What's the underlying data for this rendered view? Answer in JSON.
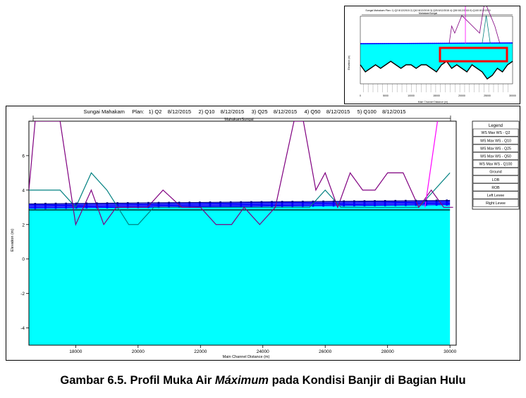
{
  "caption": {
    "prefix": "Gambar 6.5. Profil Muka Air ",
    "italic": "Máximum",
    "suffix": " pada Kondisi Banjir di Bagian Hulu"
  },
  "colors": {
    "water_fill": "#00ffff",
    "ws": "#0000ff",
    "ground": "#000000",
    "lob": "#008080",
    "rob": "#800080",
    "left_levee": "#ff00ff",
    "right_levee": "#00008b",
    "zoom_box": "#ff0000"
  },
  "chart_data": [
    {
      "type": "line",
      "title": "Sungai Mahakam     Plan:   1) Q2    8/12/2015     2) Q10    8/12/2015     3) Q25    8/12/2015     4) Q50    8/12/2015     5) Q100    8/12/2015",
      "reach_label": "MahakamSungai",
      "xlabel": "Main Channel Distance (m)",
      "ylabel": "Elevation (m)",
      "xlim": [
        16500,
        30200
      ],
      "ylim": [
        -5,
        8
      ],
      "x_ticks": [
        "18000",
        "20000",
        "22000",
        "24000",
        "26000",
        "28000",
        "30000"
      ],
      "y_ticks": [
        "-4",
        "-2",
        "0",
        "2",
        "4",
        "6"
      ],
      "grid": false,
      "legend_position": "right",
      "legend": {
        "title": "Legend",
        "items": [
          "WS Max WS - Q2",
          "WS Max WS - Q10",
          "WS Max WS - Q25",
          "WS Max WS - Q50",
          "WS Max WS - Q100",
          "Ground",
          "LOB",
          "ROB",
          "Left Levee",
          "Right Levee"
        ]
      },
      "series": [
        {
          "name": "WS Max WS - Q2",
          "x": [
            16500,
            30000
          ],
          "y": [
            2.95,
            3.15
          ]
        },
        {
          "name": "WS Max WS - Q10",
          "x": [
            16500,
            30000
          ],
          "y": [
            3.0,
            3.2
          ]
        },
        {
          "name": "WS Max WS - Q25",
          "x": [
            16500,
            30000
          ],
          "y": [
            3.05,
            3.25
          ]
        },
        {
          "name": "WS Max WS - Q50",
          "x": [
            16500,
            30000
          ],
          "y": [
            3.1,
            3.3
          ]
        },
        {
          "name": "WS Max WS - Q100",
          "x": [
            16500,
            30000
          ],
          "y": [
            3.15,
            3.35
          ]
        },
        {
          "name": "Ground",
          "x": [
            16500,
            30000
          ],
          "y": [
            2.85,
            2.85
          ]
        },
        {
          "name": "LOB",
          "x": [
            16500,
            17500,
            18000,
            18500,
            19000,
            19700,
            20000,
            20500,
            21000,
            22000,
            22500,
            23000,
            23500,
            24000,
            24500,
            25000,
            25500,
            26000,
            26500,
            27000,
            27500,
            28000,
            28500,
            29000,
            29500,
            30000
          ],
          "y": [
            4.0,
            4.0,
            3.0,
            5.0,
            4.0,
            2.0,
            2.0,
            3.0,
            3.0,
            3.0,
            3.0,
            3.0,
            3.0,
            3.0,
            3.0,
            3.0,
            3.0,
            4.0,
            3.0,
            3.0,
            3.0,
            3.0,
            3.0,
            3.0,
            4.0,
            5.0
          ]
        },
        {
          "name": "ROB",
          "x": [
            16500,
            16700,
            17500,
            18000,
            18500,
            18900,
            19300,
            19800,
            20300,
            20800,
            21400,
            22000,
            22500,
            23000,
            23400,
            23900,
            24400,
            25000,
            25300,
            25700,
            26000,
            26400,
            26800,
            27200,
            27600,
            28000,
            28500,
            29000,
            29400,
            29800,
            30100
          ],
          "y": [
            4.0,
            8.0,
            8.0,
            2.0,
            4.0,
            2.0,
            3.0,
            3.0,
            3.0,
            4.0,
            3.0,
            3.0,
            2.0,
            2.0,
            3.0,
            2.0,
            3.0,
            8.0,
            8.0,
            4.0,
            5.0,
            3.0,
            5.0,
            4.0,
            4.0,
            5.0,
            5.0,
            3.0,
            4.0,
            3.0,
            3.0
          ]
        },
        {
          "name": "Left Levee",
          "x": [
            29200,
            29600
          ],
          "y": [
            3.0,
            8.0
          ]
        },
        {
          "name": "Right Levee",
          "x": [
            16500,
            30000
          ],
          "y": [
            3.2,
            3.4
          ]
        }
      ]
    },
    {
      "type": "line",
      "title": "Sungai Mahakam     Plan:   1) Q2    8/12/2015     2) Q10    8/12/2015     3) Q25    8/12/2015     4) Q50    8/12/2015     5) Q100    8/12/2015",
      "reach_label": "MahakamSungai",
      "xlabel": "Main Channel Distance (m)",
      "ylabel": "Elevation (m)",
      "x_ticks": [
        "0",
        "5000",
        "10000",
        "15000",
        "20000",
        "25000",
        "30000"
      ],
      "grid": false,
      "series": [
        {
          "name": "WS",
          "x": [
            0,
            30000
          ],
          "y": [
            3.0,
            3.2
          ]
        },
        {
          "name": "Ground",
          "x": [
            0,
            1000,
            2000,
            3000,
            4000,
            5000,
            6000,
            7000,
            8000,
            9000,
            10000,
            11000,
            12000,
            13000,
            14000,
            15000,
            16000,
            17000,
            18000,
            19000,
            20000,
            21000,
            22000,
            23000,
            24000,
            25000,
            26000,
            27000,
            28000,
            29000,
            30000
          ],
          "y": [
            -3,
            -5,
            -4,
            -3,
            -4,
            -3,
            -2,
            -3,
            -4,
            -3,
            -3,
            -4,
            -3,
            -3,
            -4,
            -5,
            -3,
            -2,
            -4,
            -3,
            -4,
            -5,
            -3,
            -4,
            -5,
            -7,
            -6,
            -4,
            -5,
            -3,
            -2
          ]
        }
      ]
    }
  ]
}
